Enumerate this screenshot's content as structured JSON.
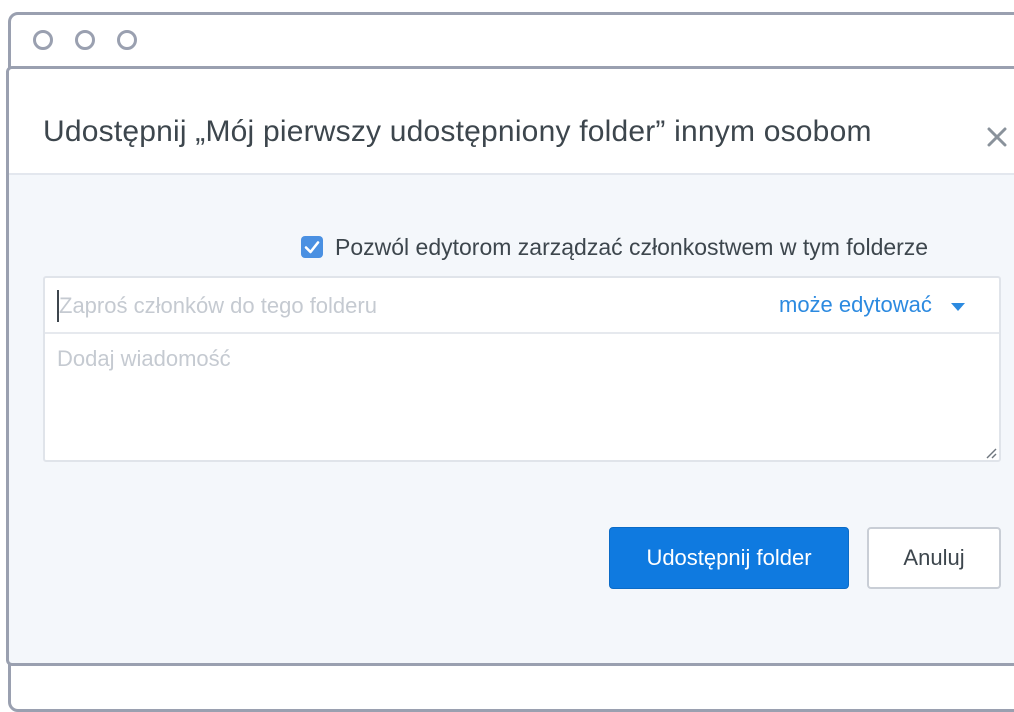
{
  "dialog": {
    "title": "Udostępnij „Mój pierwszy udostępniony folder” innym osobom"
  },
  "options": {
    "allow_editors_manage_label": "Pozwól edytorom zarządzać członkostwem w tym folderze",
    "allow_editors_manage_checked": true
  },
  "invite": {
    "placeholder": "Zaproś członków do tego folderu",
    "value": "",
    "permission": "może edytować"
  },
  "message": {
    "placeholder": "Dodaj wiadomość",
    "value": ""
  },
  "actions": {
    "share_label": "Udostępnij folder",
    "cancel_label": "Anuluj"
  },
  "icons": {
    "close": "close-icon",
    "check": "check-icon",
    "dropdown": "caret-down-icon",
    "resize": "resize-handle-icon"
  },
  "colors": {
    "accent": "#0f7ae0",
    "link": "#2c8ae0",
    "checkbox": "#4a90e2",
    "dialog_body": "#f4f7fb",
    "text": "#3d464d",
    "placeholder": "#c5cad1"
  }
}
